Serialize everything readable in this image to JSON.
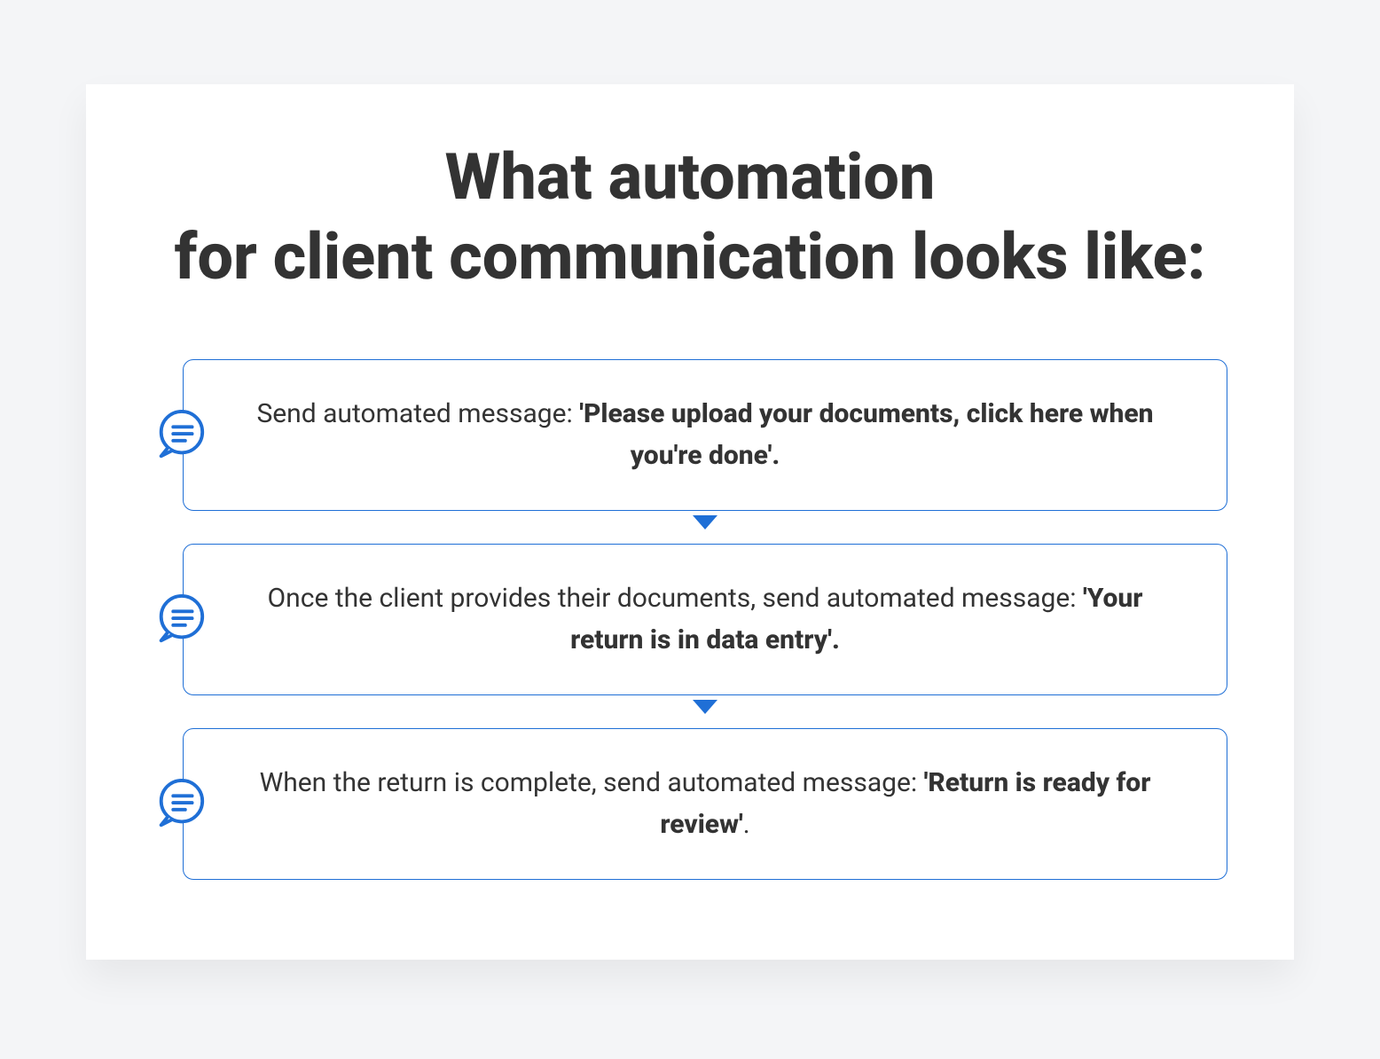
{
  "colors": {
    "background": "#f4f5f7",
    "card": "#ffffff",
    "border": "#1f6fd6",
    "text": "#333333",
    "accent": "#1f6fd6"
  },
  "title_line1": "What automation",
  "title_line2": "for client communication looks like:",
  "steps": [
    {
      "icon": "chat-icon",
      "prefix": "Send automated message: ",
      "bold": "'Please upload your documents, click here when you're done'.",
      "suffix": ""
    },
    {
      "icon": "chat-icon",
      "prefix": "Once the client provides their documents, send automated message: ",
      "bold": "'Your return is in data entry'.",
      "suffix": ""
    },
    {
      "icon": "chat-icon",
      "prefix": "When the return is complete, send automated message: ",
      "bold": "'Return is ready for review'",
      "suffix": "."
    }
  ]
}
